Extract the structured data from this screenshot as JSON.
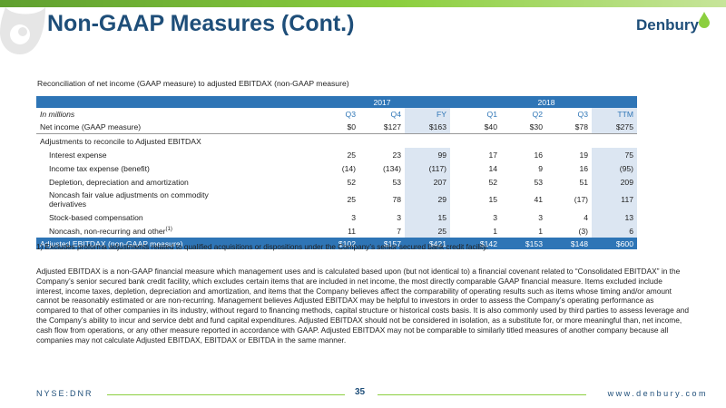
{
  "header": {
    "title": "Non-GAAP Measures (Cont.)",
    "logo_text": "Denbury"
  },
  "table": {
    "title": "Reconciliation of net income (GAAP measure) to adjusted EBITDAX (non-GAAP measure)",
    "years": [
      "2017",
      "2018"
    ],
    "units_label": "In millions",
    "periods": [
      "Q3",
      "Q4",
      "FY",
      "Q1",
      "Q2",
      "Q3",
      "TTM"
    ],
    "net_income": {
      "label": "Net income (GAAP measure)",
      "values": [
        "$0",
        "$127",
        "$163",
        "$40",
        "$30",
        "$78",
        "$275"
      ]
    },
    "adjustments_label": "Adjustments to reconcile to Adjusted EBITDAX",
    "rows": [
      {
        "label": "Interest expense",
        "values": [
          "25",
          "23",
          "99",
          "17",
          "16",
          "19",
          "75"
        ]
      },
      {
        "label": "Income tax expense (benefit)",
        "values": [
          "(14)",
          "(134)",
          "(117)",
          "14",
          "9",
          "16",
          "(95)"
        ]
      },
      {
        "label": "Depletion, depreciation and amortization",
        "values": [
          "52",
          "53",
          "207",
          "52",
          "53",
          "51",
          "209"
        ]
      },
      {
        "label_line1": "Noncash fair value adjustments on commodity",
        "label_line2": "derivatives",
        "values": [
          "25",
          "78",
          "29",
          "15",
          "41",
          "(17)",
          "117"
        ]
      },
      {
        "label": "Stock-based compensation",
        "values": [
          "3",
          "3",
          "15",
          "3",
          "3",
          "4",
          "13"
        ]
      },
      {
        "label": "Noncash, non-recurring and other",
        "footnote_mark": "(1)",
        "values": [
          "11",
          "7",
          "25",
          "1",
          "1",
          "(3)",
          "6"
        ]
      }
    ],
    "total": {
      "label": "Adjusted EBITDAX (non-GAAP measure)",
      "values": [
        "$102",
        "$157",
        "$421",
        "$142",
        "$153",
        "$148",
        "$600"
      ]
    }
  },
  "footnote": "1) Excludes proforma adjustments related to qualified acquisitions or dispositions under the Company’s senior secured bank credit facility.",
  "paragraph": "Adjusted EBITDAX is a non-GAAP financial measure which management uses and is calculated based upon (but not identical to) a financial covenant related to “Consolidated EBITDAX” in the Company’s senior secured bank credit facility, which excludes certain items that are included in net income, the most directly comparable GAAP financial measure. Items excluded include interest, income taxes, depletion, depreciation and amortization, and items that the Company believes affect the comparability of operating results such as items whose timing and/or amount cannot be reasonably estimated or are non-recurring. Management believes Adjusted EBITDAX may be helpful to investors in order to assess the Company’s operating performance as compared to that of other companies in its industry, without regard to financing methods, capital structure or historical costs basis. It is also commonly used by third parties to assess leverage and the Company’s ability to incur and service debt and fund capital expenditures. Adjusted EBITDAX should not be considered in isolation, as a substitute for, or more meaningful than, net income, cash flow from operations, or any other measure reported in accordance with GAAP. Adjusted EBITDAX may not be comparable to similarly titled measures of another company because all companies may not calculate Adjusted EBITDAX, EBITDAX or EBITDA in the same manner.",
  "footer": {
    "left": "NYSE:DNR",
    "page": "35",
    "right": "www.denbury.com"
  },
  "colors": {
    "brand_blue": "#1e4e79",
    "table_blue": "#2e75b6",
    "accent_green": "#8ccf3f",
    "highlight": "#dce6f2"
  }
}
